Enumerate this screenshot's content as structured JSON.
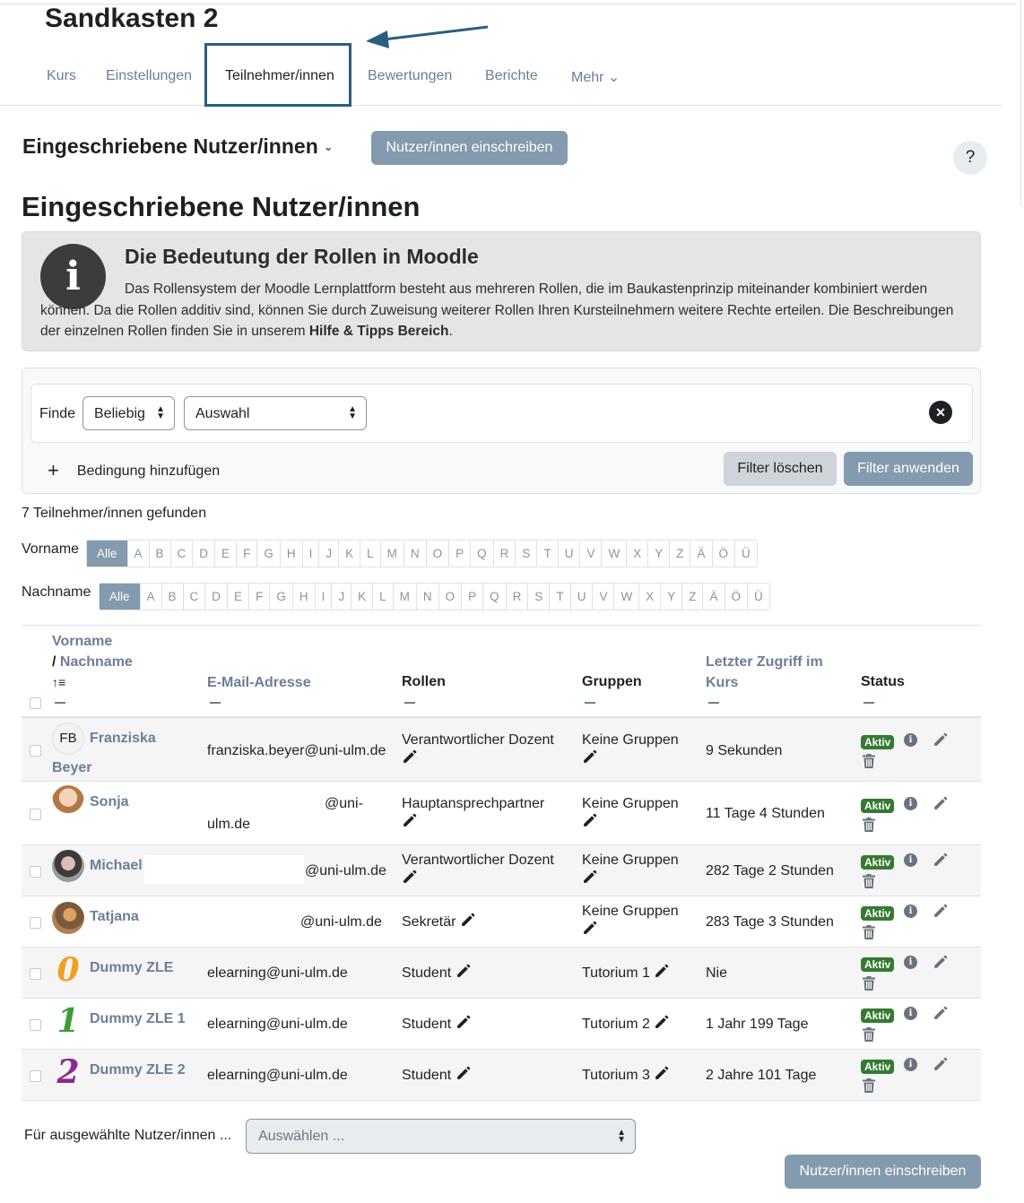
{
  "course": {
    "title": "Sandkasten 2"
  },
  "nav": {
    "items": [
      {
        "label": "Kurs"
      },
      {
        "label": "Einstellungen"
      },
      {
        "label": "Teilnehmer/innen"
      },
      {
        "label": "Bewertungen"
      },
      {
        "label": "Berichte"
      },
      {
        "label": "Mehr ⌄"
      }
    ],
    "active_index": 2
  },
  "header": {
    "selector_label": "Eingeschriebene Nutzer/innen",
    "enrol_button": "Nutzer/innen einschreiben",
    "help": "?"
  },
  "page_title": "Eingeschriebene Nutzer/innen",
  "infobox": {
    "title": "Die Bedeutung der Rollen in Moodle",
    "text": "Das Rollensystem der Moodle Lernplattform besteht aus mehreren Rollen, die im Baukastenprinzip miteinander kombiniert werden können. Da die Rollen additiv sind, können Sie durch Zuweisung weiterer Rollen Ihren Kursteilnehmern weitere Rechte erteilen. Die Beschreibungen der einzelnen Rollen finden Sie in unserem ",
    "link": "Hilfe & Tipps Bereich",
    "end": "."
  },
  "filter": {
    "finde_label": "Finde",
    "match_select": "Beliebig",
    "type_select": "Auswahl",
    "add_condition": "Bedingung hinzufügen",
    "clear_button": "Filter löschen",
    "apply_button": "Filter anwenden"
  },
  "found_text": "7 Teilnehmer/innen gefunden",
  "initials": {
    "firstname_label": "Vorname",
    "lastname_label": "Nachname",
    "all": "Alle",
    "letters": [
      "A",
      "B",
      "C",
      "D",
      "E",
      "F",
      "G",
      "H",
      "I",
      "J",
      "K",
      "L",
      "M",
      "N",
      "O",
      "P",
      "Q",
      "R",
      "S",
      "T",
      "U",
      "V",
      "W",
      "X",
      "Y",
      "Z",
      "Ä",
      "Ö",
      "Ü"
    ]
  },
  "table": {
    "headers": {
      "firstname": "Vorname",
      "lastname": "/ Nachname",
      "sort_icon": "↑≡",
      "email": "E-Mail-Adresse",
      "roles": "Rollen",
      "groups": "Gruppen",
      "last_access_1": "Letzter Zugriff im",
      "last_access_2": "Kurs",
      "status": "Status"
    },
    "status_badge": "Aktiv",
    "rows": [
      {
        "avatar": "FB",
        "first": "Franziska",
        "last": "Beyer",
        "email": "franziska.beyer@uni-ulm.de",
        "role": "Verantwortlicher Dozent",
        "group": "Keine Gruppen",
        "access": "9 Sekunden"
      },
      {
        "first": "Sonja",
        "email_a": "@uni-",
        "email_b": "ulm.de",
        "role": "Hauptansprechpartner",
        "group": "Keine Gruppen",
        "access": "11 Tage 4 Stunden"
      },
      {
        "first": "Michael",
        "email": "@uni-ulm.de",
        "role": "Verantwortlicher Dozent",
        "group": "Keine Gruppen",
        "access": "282 Tage 2 Stunden"
      },
      {
        "first": "Tatjana",
        "email": "@uni-ulm.de",
        "role": "Sekretär",
        "group": "Keine Gruppen",
        "access": "283 Tage 3 Stunden"
      },
      {
        "avatar": "0",
        "avatar_color": "#f0a020",
        "first": "Dummy ZLE",
        "email": "elearning@uni-ulm.de",
        "role": "Student",
        "group": "Tutorium 1",
        "access": "Nie"
      },
      {
        "avatar": "1",
        "avatar_color": "#3aa035",
        "first": "Dummy ZLE 1",
        "email": "elearning@uni-ulm.de",
        "role": "Student",
        "group": "Tutorium 2",
        "access": "1 Jahr 199 Tage"
      },
      {
        "avatar": "2",
        "avatar_color": "#8a2a90",
        "first": "Dummy ZLE 2",
        "email": "elearning@uni-ulm.de",
        "role": "Student",
        "group": "Tutorium 3",
        "access": "2 Jahre 101 Tage"
      }
    ]
  },
  "bulk": {
    "label": "Für ausgewählte Nutzer/innen ...",
    "select_placeholder": "Auswählen ...",
    "enrol_button": "Nutzer/innen einschreiben"
  },
  "colors": {
    "accent": "#849aae",
    "link": "#6a7f96",
    "badge": "#357a32",
    "highlight_box": "#2a5f7f"
  },
  "icons": [
    "pencil-icon",
    "info-icon",
    "trash-icon",
    "sort-icon",
    "close-icon",
    "plus-icon",
    "help-icon",
    "arrow-annotation"
  ]
}
